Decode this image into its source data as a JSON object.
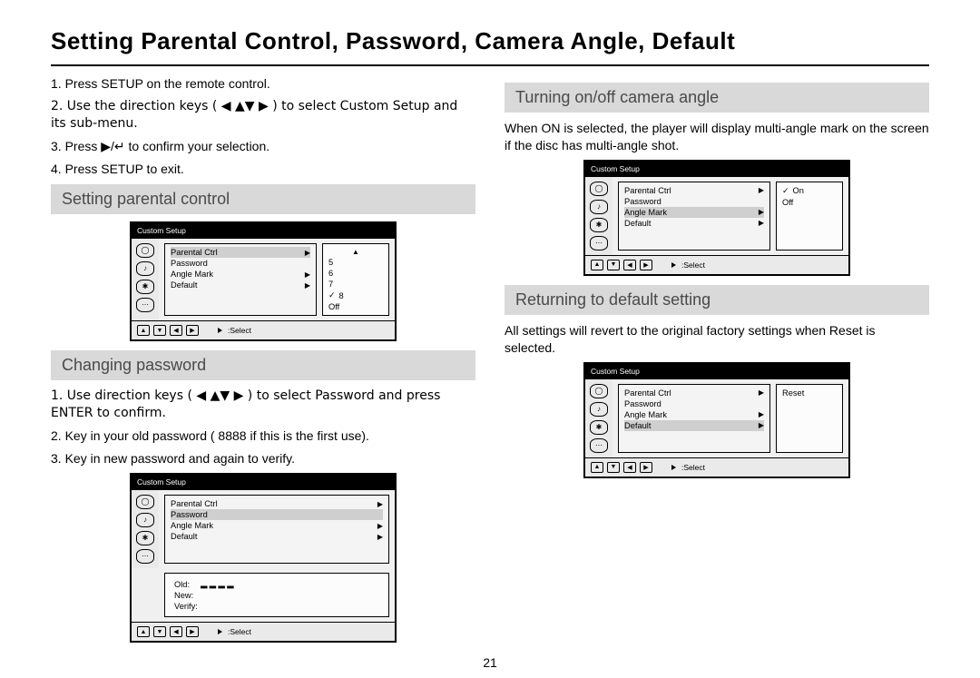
{
  "page_title": "Setting Parental Control, Password, Camera Angle, Default",
  "page_number": "21",
  "intro_steps": [
    "1. Press SETUP on the remote control.",
    "2. Use the direction keys ( ◀ ▲▼ ▶ ) to select Custom Setup and its sub-menu.",
    "3. Press ▶/↵ to confirm your selection.",
    "4. Press SETUP to exit."
  ],
  "sections": {
    "parental": {
      "title": "Setting parental control"
    },
    "password": {
      "title": "Changing password",
      "steps": [
        "1. Use direction keys ( ◀ ▲▼ ▶ ) to select Password and press ENTER to confirm.",
        "2. Key in your old password ( 8888 if this is the first use).",
        "3. Key in new password and again to verify."
      ]
    },
    "angle": {
      "title": "Turning on/off camera angle",
      "desc": "When ON is selected, the player will display multi-angle mark on the screen if the disc has multi-angle shot."
    },
    "default": {
      "title": "Returning to default setting",
      "desc": "All settings will revert to the original factory settings when Reset is selected."
    }
  },
  "dvd": {
    "title": "Custom Setup",
    "menu": [
      "Parental Ctrl",
      "Password",
      "Angle Mark",
      "Default"
    ],
    "footer_select": ":Select",
    "parental_opts": [
      "5",
      "6",
      "7",
      "8",
      "Off"
    ],
    "parental_checked": "8",
    "angle_opts": [
      "On",
      "Off"
    ],
    "angle_checked": "On",
    "default_opts": [
      "Reset"
    ],
    "pwd_labels": {
      "old": "Old:",
      "new": "New:",
      "verify": "Verify:"
    },
    "tab_icons": [
      "icon-general",
      "icon-audio",
      "icon-video",
      "icon-custom"
    ],
    "scroll_up": "▲"
  }
}
